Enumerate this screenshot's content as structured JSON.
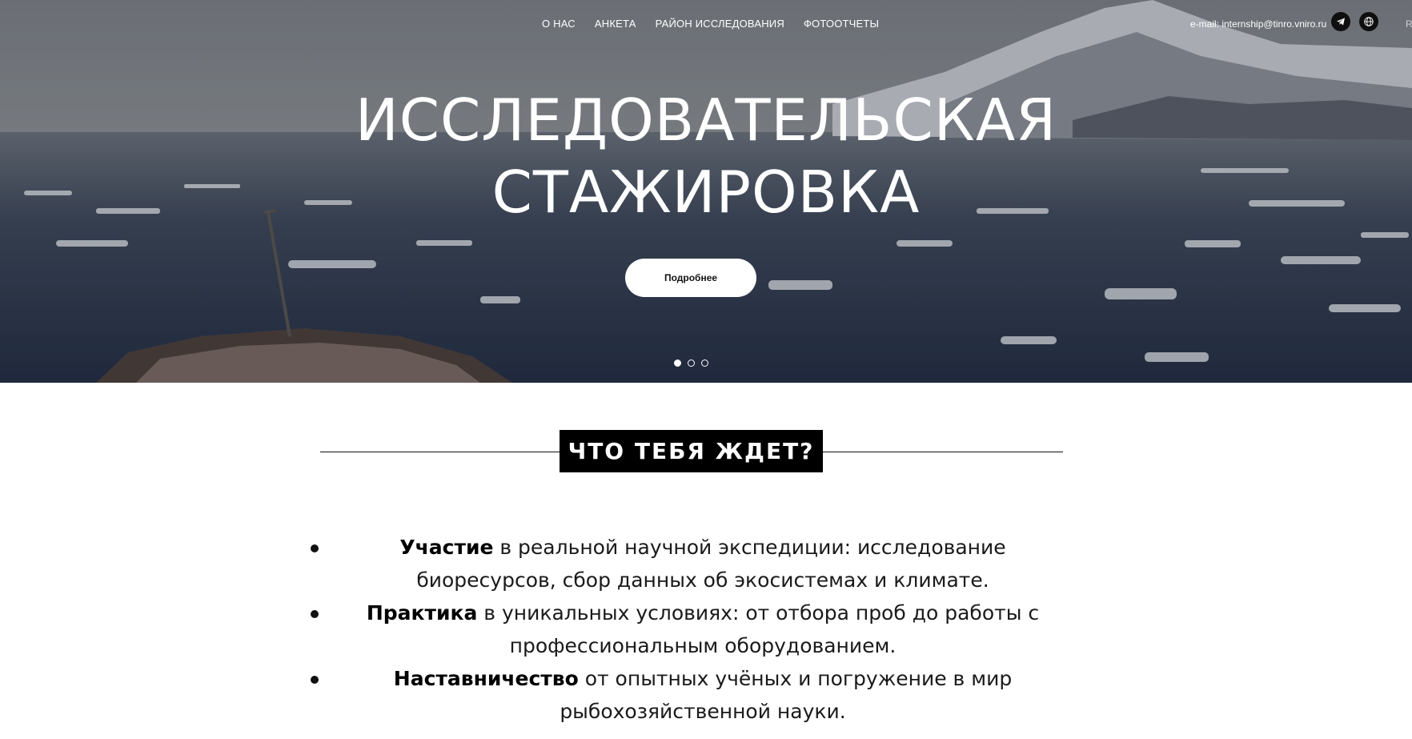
{
  "nav": {
    "links": [
      "О НАС",
      "АНКЕТА",
      "РАЙОН ИССЛЕДОВАНИЯ",
      "ФОТООТЧЕТЫ"
    ],
    "email": "e-mail: internship@tinro.vniro.ru",
    "icons": [
      "telegram-icon",
      "globe-icon"
    ],
    "cut_text": "R"
  },
  "hero": {
    "title_line1": "ИССЛЕДОВАТЕЛЬСКАЯ",
    "title_line2": "СТАЖИРОВКА",
    "button": "Подробнее",
    "slides_total": 3,
    "slide_active": 1
  },
  "section": {
    "heading": "ЧТО ТЕБЯ ЖДЕТ?",
    "bullets": [
      {
        "bold": "Участие",
        "text": " в реальной научной экспедиции: исследование биоресурсов, сбор данных об экосистемах и климате."
      },
      {
        "bold": "Практика",
        "text": " в уникальных условиях: от отбора проб до работы с профессиональным оборудованием."
      },
      {
        "bold": "Наставничество",
        "text": " от опытных учёных и погружение в мир рыбохозяйственной науки."
      }
    ]
  },
  "colors": {
    "heading_bg": "#000000",
    "hero_text": "#ffffff",
    "button_bg": "#ffffff"
  }
}
